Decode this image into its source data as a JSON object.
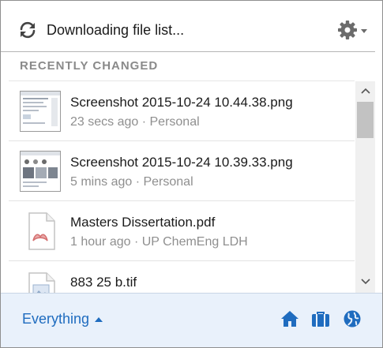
{
  "header": {
    "status_text": "Downloading file list...",
    "sync_icon": "sync-icon",
    "settings_icon": "gear-icon"
  },
  "section": {
    "title": "RECENTLY CHANGED"
  },
  "files": [
    {
      "name": "Screenshot 2015-10-24 10.44.38.png",
      "meta": "23 secs ago · Personal",
      "thumbnail": "screenshot-thumbnail"
    },
    {
      "name": "Screenshot 2015-10-24 10.39.33.png",
      "meta": "5 mins ago · Personal",
      "thumbnail": "screenshot-thumbnail"
    },
    {
      "name": "Masters Dissertation.pdf",
      "meta": "1 hour ago · UP ChemEng LDH",
      "thumbnail": "pdf-file-icon"
    },
    {
      "name": "883 25 b.tif",
      "meta": "",
      "thumbnail": "image-file-icon"
    }
  ],
  "footer": {
    "filter_label": "Everything",
    "icons": [
      "home-icon",
      "briefcase-icon",
      "globe-icon"
    ]
  },
  "colors": {
    "accent": "#1f6cbf",
    "footer_bg": "#e9f1fb",
    "muted_text": "#8f8f8f"
  }
}
